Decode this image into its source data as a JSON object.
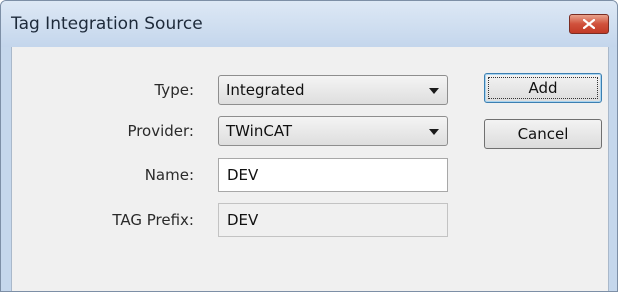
{
  "window": {
    "title": "Tag Integration Source",
    "close_icon": "close-icon"
  },
  "form": {
    "type": {
      "label": "Type:",
      "value": "Integrated"
    },
    "provider": {
      "label": "Provider:",
      "value": "TWinCAT"
    },
    "name": {
      "label": "Name:",
      "value": "DEV"
    },
    "tag_prefix": {
      "label": "TAG Prefix:",
      "value": "DEV"
    }
  },
  "buttons": {
    "add_label": "Add",
    "cancel_label": "Cancel"
  },
  "colors": {
    "title_bar": "#c5d7ec",
    "close_button": "#d0513c",
    "dialog_body": "#f0f0f0"
  }
}
